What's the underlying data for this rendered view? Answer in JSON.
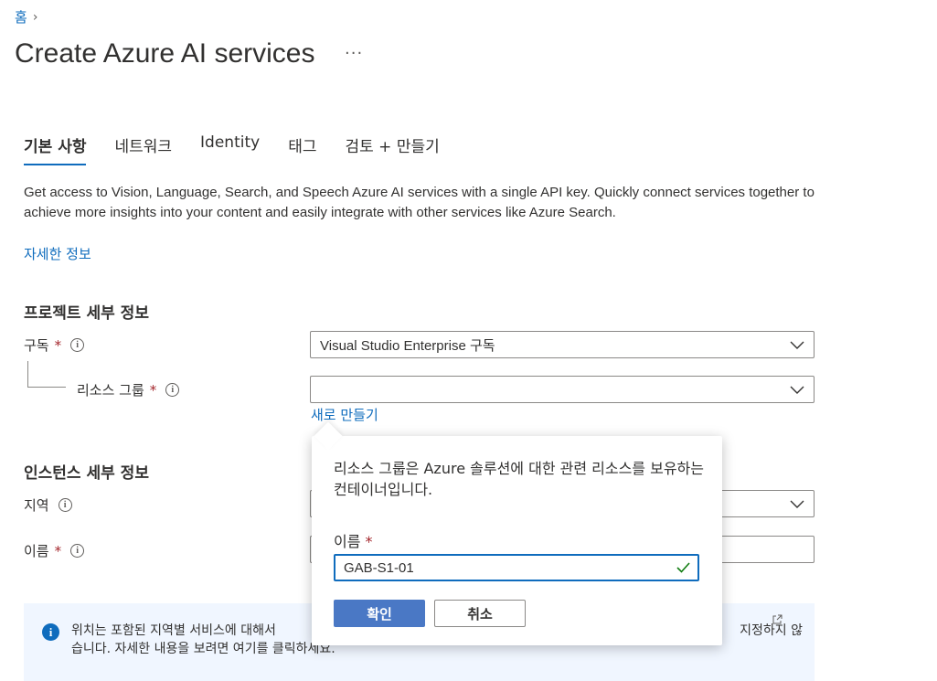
{
  "breadcrumb": {
    "home": "홈"
  },
  "page": {
    "title": "Create Azure AI services",
    "more": "···"
  },
  "tabs": [
    {
      "label": "기본 사항"
    },
    {
      "label": "네트워크"
    },
    {
      "label": "Identity"
    },
    {
      "label": "태그"
    },
    {
      "label": "검토 + 만들기"
    }
  ],
  "description": "Get access to Vision, Language, Search, and Speech Azure AI services with a single API key. Quickly connect services together to achieve more insights into your content and easily integrate with other services like Azure Search.",
  "learn_more": "자세한 정보",
  "project_details": {
    "title": "프로젝트 세부 정보",
    "subscription_label": "구독",
    "subscription_value": "Visual Studio Enterprise 구독",
    "resource_group_label": "리소스 그룹",
    "resource_group_value": "",
    "create_new": "새로 만들기",
    "required_mark": "*"
  },
  "instance_details": {
    "title": "인스턴스 세부 정보",
    "region_label": "지역",
    "name_label": "이름",
    "required_mark": "*"
  },
  "info_banner": {
    "text_line1_left": "위치는 포함된 지역별 서비스에 대해서",
    "text_line1_right": "지정하지 않",
    "text_line2": "습니다. 자세한 내용을 보려면 여기를 클릭하세요."
  },
  "popup": {
    "message": "리소스 그룹은 Azure 솔루션에 대한 관련 리소스를 보유하는 컨테이너입니다.",
    "name_label": "이름",
    "required_mark": "*",
    "name_value": "GAB-S1-01",
    "ok_label": "확인",
    "cancel_label": "취소"
  },
  "colors": {
    "accent": "#0f6cbd",
    "required": "#a4262c",
    "ok_button": "#4a78c5",
    "valid_check": "#107c10"
  }
}
